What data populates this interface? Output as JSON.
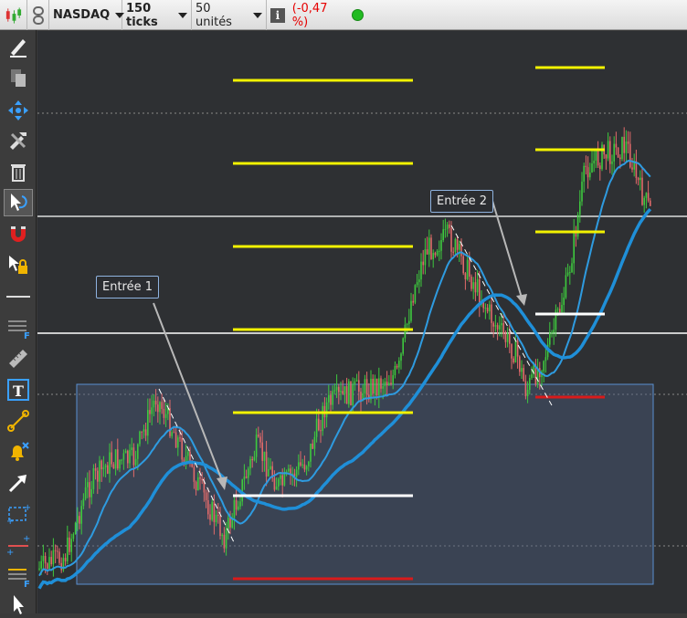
{
  "toolbar": {
    "symbol": "NASDAQ",
    "period": "150 ticks",
    "volume": "50 unités",
    "change": "(-0,47 %)",
    "change_color": "#e60000",
    "status_color": "#22bb22"
  },
  "sidebar": {
    "tools": [
      "pencil-icon",
      "copy-icon",
      "move-icon",
      "tools-icon",
      "trash-icon",
      "cursor-rotate-icon",
      "magnet-icon",
      "lock-cursor-icon",
      "horizontal-line-icon",
      "fibonacci-icon",
      "ruler-icon",
      "text-icon",
      "trendline-icon",
      "alert-bell-icon",
      "arrow-icon",
      "channel-icon",
      "parallel-lines-icon",
      "fibonacci-extension-icon",
      "pointer-icon"
    ]
  },
  "annotations": {
    "entry1": "Entrée 1",
    "entry2": "Entrée 2"
  },
  "colors": {
    "up_candle": "#3ec93e",
    "down_candle": "#e06a6a",
    "ma_fast": "#2e9be0",
    "ma_slow": "#1f8fd8",
    "target_line": "#f2f200",
    "entry_line": "#ffffff",
    "stop_line": "#d81b1b",
    "zone_fill": "#4a5a7a"
  }
}
